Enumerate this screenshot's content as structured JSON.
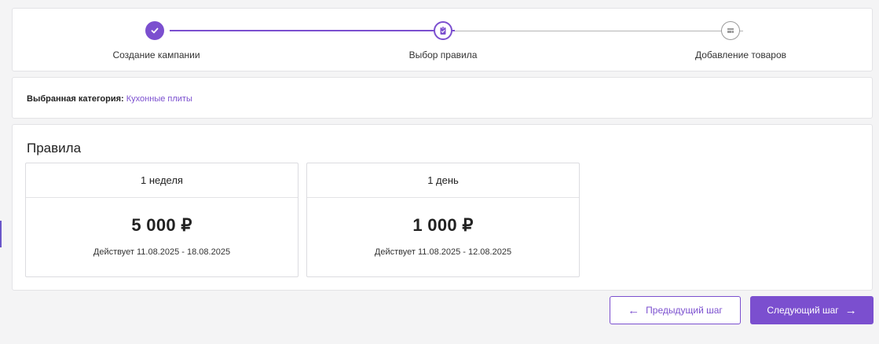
{
  "colors": {
    "accent": "#7b4fcf",
    "inactive": "#9a9a9a",
    "background": "#f4f4f5"
  },
  "stepper": {
    "steps": [
      {
        "label": "Создание кампании",
        "state": "done",
        "icon": "check-icon"
      },
      {
        "label": "Выбор правила",
        "state": "current",
        "icon": "clipboard-check-icon"
      },
      {
        "label": "Добавление товаров",
        "state": "future",
        "icon": "boxes-icon"
      }
    ]
  },
  "category": {
    "key": "Выбранная категория:",
    "value": "Кухонные плиты"
  },
  "rules": {
    "title": "Правила",
    "items": [
      {
        "name": "1 неделя",
        "price": "5 000 ₽",
        "period": "Действует 11.08.2025 - 18.08.2025"
      },
      {
        "name": "1 день",
        "price": "1 000 ₽",
        "period": "Действует 11.08.2025 - 12.08.2025"
      }
    ]
  },
  "buttons": {
    "prev_label": "Предыдущий шаг",
    "next_label": "Следующий шаг"
  }
}
